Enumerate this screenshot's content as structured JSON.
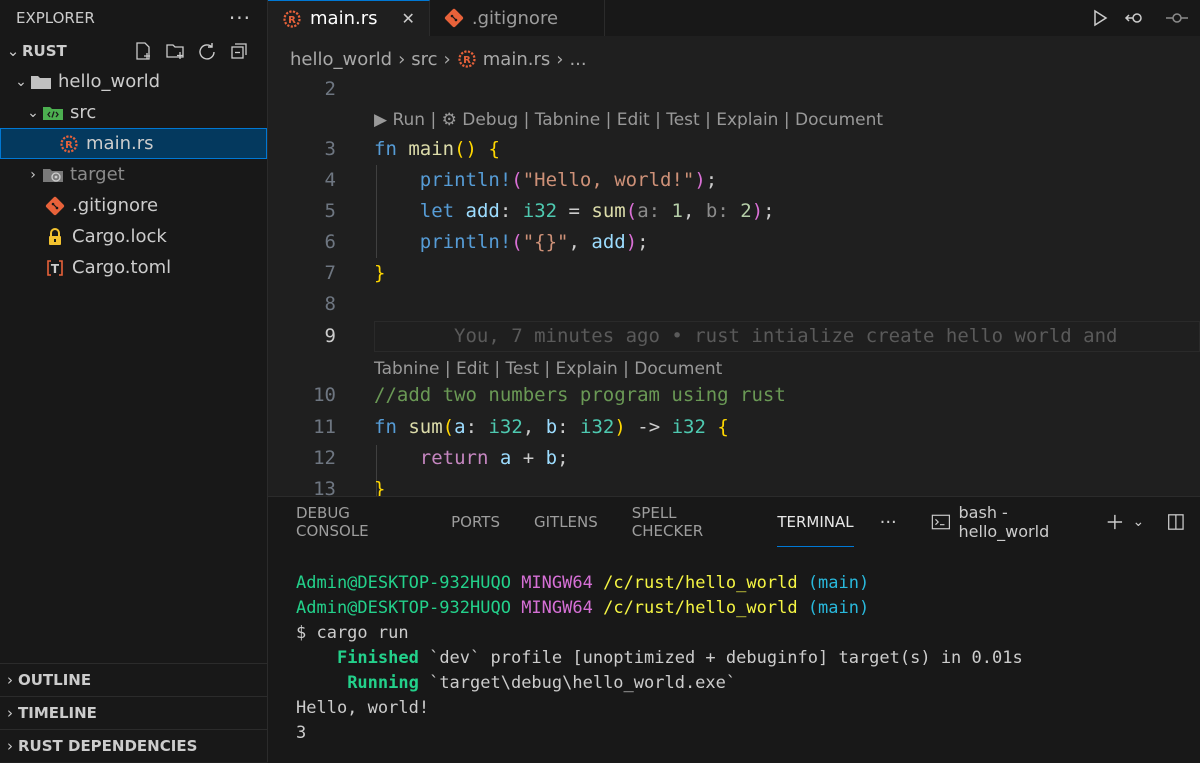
{
  "sidebar": {
    "header": "EXPLORER",
    "more": "···",
    "section": "RUST",
    "tree": [
      {
        "label": "hello_world",
        "chev": "⌄",
        "indent": 0
      },
      {
        "label": "src",
        "chev": "⌄",
        "indent": 1
      },
      {
        "label": "main.rs",
        "chev": "",
        "indent": 2
      },
      {
        "label": "target",
        "chev": "›",
        "indent": 1
      },
      {
        "label": ".gitignore",
        "chev": "",
        "indent": 1
      },
      {
        "label": "Cargo.lock",
        "chev": "",
        "indent": 1
      },
      {
        "label": "Cargo.toml",
        "chev": "",
        "indent": 1
      }
    ],
    "bottom_sections": [
      "OUTLINE",
      "TIMELINE",
      "RUST DEPENDENCIES"
    ]
  },
  "tabs": [
    {
      "label": "main.rs",
      "active": true
    },
    {
      "label": ".gitignore",
      "active": false
    }
  ],
  "tab_close": "✕",
  "breadcrumb": [
    "hello_world",
    "src",
    "main.rs",
    "..."
  ],
  "code": {
    "lines": {
      "l2": "2",
      "l3": "3",
      "l4": "4",
      "l5": "5",
      "l6": "6",
      "l7": "7",
      "l8": "8",
      "l9": "9",
      "l10": "10",
      "l11": "11",
      "l12": "12",
      "l13": "13"
    },
    "lens1": "▶ Run | ⚙ Debug | Tabnine | Edit | Test | Explain | Document",
    "lens2": "Tabnine | Edit | Test | Explain | Document",
    "blame": "You, 7 minutes ago • rust intialize create hello world and",
    "comment": "//add two numbers program using rust",
    "str_hello": "\"Hello, world!\"",
    "str_fmt": "\"{}\""
  },
  "panel": {
    "tabs": [
      "DEBUG CONSOLE",
      "PORTS",
      "GITLENS",
      "SPELL CHECKER",
      "TERMINAL"
    ],
    "active_tab": "TERMINAL",
    "more": "···",
    "shell": "bash - hello_world"
  },
  "terminal": {
    "user_host": "Admin@DESKTOP-932HUQO",
    "env": "MINGW64",
    "path": "/c/rust/hello_world",
    "branch": "(main)",
    "command": "$ cargo run",
    "finished_label": "Finished",
    "finished_rest": " `dev` profile [unoptimized + debuginfo] target(s) in 0.01s",
    "running_label": "Running",
    "running_rest": " `target\\debug\\hello_world.exe`",
    "output1": "Hello, world!",
    "output2": "3"
  },
  "colors": {
    "accent": "#0078d4",
    "rust_icon": "#e8623a",
    "git_icon": "#e8623a"
  }
}
